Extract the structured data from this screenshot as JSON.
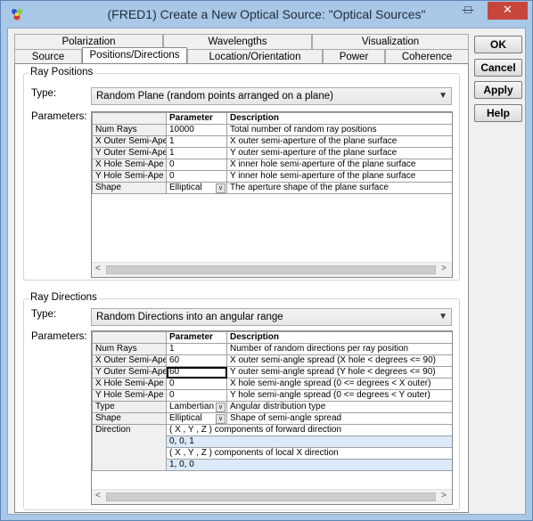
{
  "window": {
    "title": "(FRED1) Create a New Optical Source: \"Optical Sources\"",
    "min_glyph": "—",
    "max_glyph": "□",
    "close_glyph": "✕"
  },
  "buttons": {
    "ok": "OK",
    "cancel": "Cancel",
    "apply": "Apply",
    "help": "Help"
  },
  "tabs_row1": [
    "Polarization",
    "Wavelengths",
    "Visualization"
  ],
  "tabs_row2": [
    "Source",
    "Positions/Directions",
    "Location/Orientation",
    "Power",
    "Coherence"
  ],
  "active_tab": "Positions/Directions",
  "ray_positions": {
    "group_title": "Ray Positions",
    "type_label": "Type:",
    "type_value": "Random Plane (random points arranged on a plane)",
    "params_label": "Parameters:",
    "headers": [
      "Parameter",
      "Description"
    ],
    "rows": [
      {
        "name": "Num Rays",
        "value": "10000",
        "desc": "Total number of random ray positions"
      },
      {
        "name": "X Outer Semi-Ape",
        "value": "1",
        "desc": "X outer semi-aperture of the plane surface"
      },
      {
        "name": "Y Outer Semi-Ape",
        "value": "1",
        "desc": "Y outer semi-aperture of the plane surface"
      },
      {
        "name": "X Hole Semi-Ape",
        "value": "0",
        "desc": "X inner hole semi-aperture of the plane surface"
      },
      {
        "name": "Y Hole Semi-Ape",
        "value": "0",
        "desc": "Y inner hole semi-aperture of the plane surface"
      },
      {
        "name": "Shape",
        "value": "Elliptical",
        "desc": "The aperture shape of the plane surface"
      }
    ]
  },
  "ray_directions": {
    "group_title": "Ray Directions",
    "type_label": "Type:",
    "type_value": "Random Directions into an angular range",
    "params_label": "Parameters:",
    "headers": [
      "Parameter",
      "Description"
    ],
    "rows": [
      {
        "name": "Num Rays",
        "value": "1",
        "desc": "Number of random directions per ray position"
      },
      {
        "name": "X Outer Semi-Ape",
        "value": "60",
        "desc": "X outer semi-angle spread (X hole < degrees <= 90)"
      },
      {
        "name": "Y Outer Semi-Ape",
        "value": "60",
        "desc": "Y outer semi-angle spread (Y hole < degrees <= 90)"
      },
      {
        "name": "X Hole Semi-Ape",
        "value": "0",
        "desc": "X hole semi-angle spread (0 <= degrees < X outer)"
      },
      {
        "name": "Y Hole Semi-Ape",
        "value": "0",
        "desc": "Y hole semi-angle spread (0 <= degrees < Y outer)"
      },
      {
        "name": "Type",
        "value": "Lambertian",
        "desc": "Angular distribution type"
      },
      {
        "name": "Shape",
        "value": "Elliptical",
        "desc": "Shape of semi-angle spread"
      }
    ],
    "direction": {
      "name": "Direction",
      "forward_header": "( X , Y , Z ) components of forward direction",
      "forward_value": "0,  0,  1",
      "localx_header": "( X , Y , Z ) components of local X direction",
      "localx_value": "1,  0,  0"
    }
  },
  "scroll": {
    "left_glyph": "<",
    "right_glyph": ">",
    "dd_glyph": "v",
    "combo_glyph": "v"
  }
}
